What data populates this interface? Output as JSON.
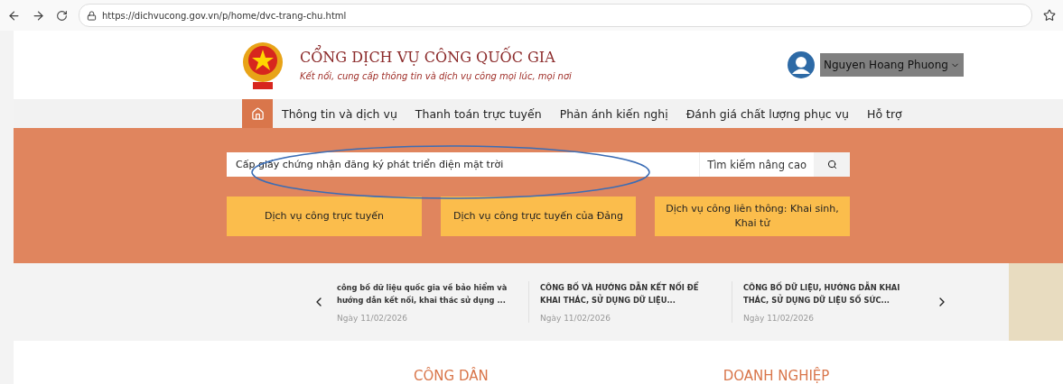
{
  "browser": {
    "url": "https://dichvucong.gov.vn/p/home/dvc-trang-chu.html"
  },
  "header": {
    "title": "CỔNG DỊCH VỤ CÔNG QUỐC GIA",
    "subtitle": "Kết nối, cung cấp thông tin và dịch vụ công mọi lúc, mọi nơi",
    "user_name": "Nguyen Hoang Phuong"
  },
  "nav": {
    "items": [
      {
        "label": "Thông tin và dịch vụ"
      },
      {
        "label": "Thanh toán trực tuyến"
      },
      {
        "label": "Phản ánh kiến nghị"
      },
      {
        "label": "Đánh giá chất lượng phục vụ"
      },
      {
        "label": "Hỗ trợ"
      }
    ]
  },
  "search": {
    "value": "Cấp giấy chứng nhận đăng ký phát triển điện mặt trời",
    "advanced_label": "Tìm kiếm nâng cao"
  },
  "service_buttons": [
    "Dịch vụ công trực tuyến",
    "Dịch vụ công trực tuyến của Đảng",
    "Dịch vụ công liên thông: Khai sinh, Khai tử"
  ],
  "news": [
    {
      "title": "công bố dữ liệu quốc gia về bảo hiểm và hướng dẫn kết nối, khai thác sử dụng ...",
      "date": "Ngày 11/02/2026"
    },
    {
      "title": "CÔNG BỐ VÀ HƯỚNG DẪN KẾT NỐI ĐỂ KHAI THÁC, SỬ DỤNG DỮ LIỆU...",
      "date": "Ngày 11/02/2026"
    },
    {
      "title": "CÔNG BỐ DỮ LIỆU, HƯỚNG DẪN KHAI THÁC, SỬ DỤNG DỮ LIỆU SỐ SỨC...",
      "date": "Ngày 11/02/2026"
    }
  ],
  "sections": [
    "CÔNG DÂN",
    "DOANH NGHIỆP"
  ]
}
